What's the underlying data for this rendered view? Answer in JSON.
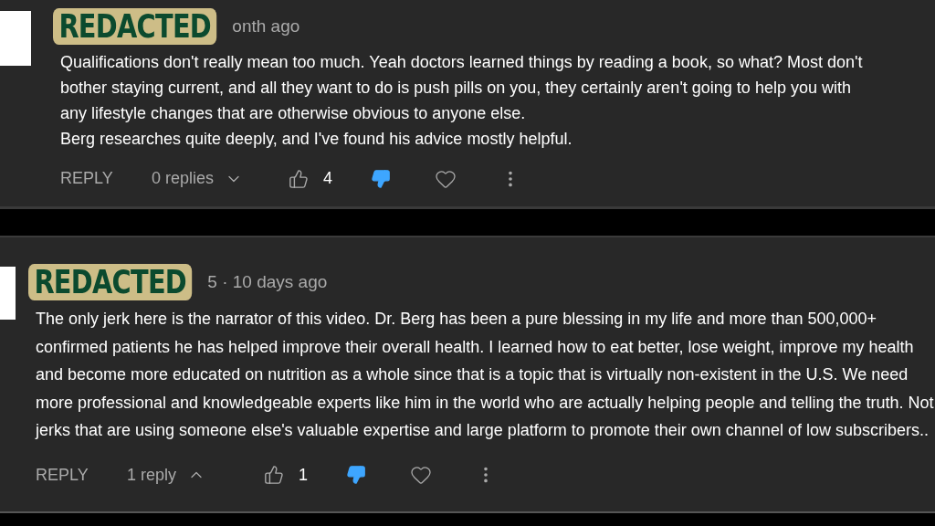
{
  "comments": [
    {
      "redaction": "REDACTED",
      "meta": "onth ago",
      "paragraphs": [
        "Qualifications don't really mean too much. Yeah doctors learned things by reading a book, so what? Most don't bother staying current, and all they want to do is push pills on you, they certainly aren't going to help you with any lifestyle changes that are otherwise obvious to anyone else.",
        "Berg researches quite deeply, and I've found his advice mostly helpful."
      ],
      "reply_label": "REPLY",
      "replies": "0 replies",
      "replies_expanded": false,
      "likes": "4",
      "liked": false,
      "disliked": true
    },
    {
      "redaction": "REDACTED",
      "meta": "5 · 10 days ago",
      "paragraphs": [
        "The only jerk here is the narrator of this video. Dr. Berg has been a pure blessing in my life and more than 500,000+ confirmed patients he has helped improve their overall health. I learned how to eat better, lose weight, improve my health and become more educated on nutrition as a whole since that is a topic that is virtually non-existent in the U.S. We need more professional and knowledgeable experts like him in the world who are actually helping people and telling the truth. Not jerks that are using someone else's valuable expertise and large platform to promote their own channel of low subscribers.."
      ],
      "reply_label": "REPLY",
      "replies": "1 reply",
      "replies_expanded": true,
      "likes": "1",
      "liked": false,
      "disliked": true
    }
  ]
}
